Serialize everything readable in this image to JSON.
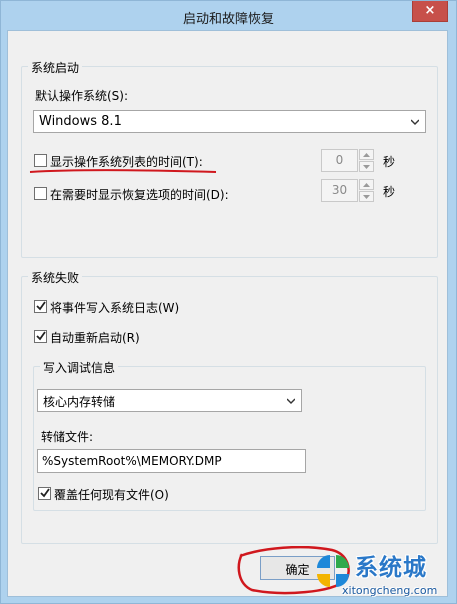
{
  "window": {
    "title": "启动和故障恢复",
    "close_glyph": "×"
  },
  "startup": {
    "group_title": "系统启动",
    "default_os_label": "默认操作系统(S):",
    "default_os_value": "Windows 8.1",
    "show_os_list": {
      "label": "显示操作系统列表的时间(T):",
      "checked": false,
      "value": "0",
      "unit": "秒"
    },
    "show_recovery": {
      "label": "在需要时显示恢复选项的时间(D):",
      "checked": false,
      "value": "30",
      "unit": "秒"
    }
  },
  "failure": {
    "group_title": "系统失败",
    "write_event_log": {
      "label": "将事件写入系统日志(W)",
      "checked": true
    },
    "auto_restart": {
      "label": "自动重新启动(R)",
      "checked": true
    },
    "debug": {
      "group_title": "写入调试信息",
      "dump_type": "核心内存转储",
      "dump_file_label": "转储文件:",
      "dump_file_value": "%SystemRoot%\\MEMORY.DMP",
      "overwrite": {
        "label": "覆盖任何现有文件(O)",
        "checked": true
      }
    }
  },
  "buttons": {
    "ok": "确定"
  },
  "watermark": {
    "brand": "系统城",
    "url": "xitongcheng.com"
  },
  "colors": {
    "title_bar": "#aed2ee",
    "close_button": "#c7504a",
    "annotation_red": "#d0181e",
    "brand_blue": "#2a78c8"
  }
}
